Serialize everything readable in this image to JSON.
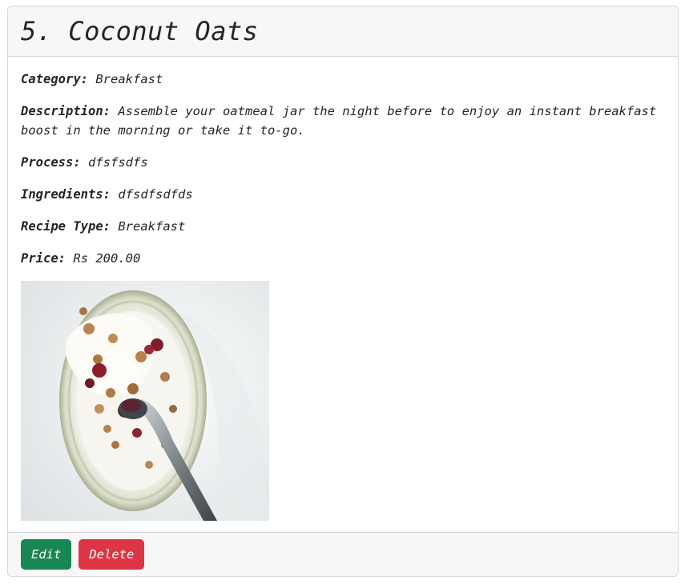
{
  "recipe": {
    "title": "5. Coconut Oats",
    "fields": [
      {
        "label": "Category:",
        "value": "Breakfast"
      },
      {
        "label": "Description:",
        "value": "Assemble your oatmeal jar the night before to enjoy an instant breakfast boost in the morning or take it to-go."
      },
      {
        "label": "Process:",
        "value": "dfsfsdfs"
      },
      {
        "label": "Ingredients:",
        "value": "dfsdfsdfds"
      },
      {
        "label": "Recipe Type:",
        "value": "Breakfast"
      },
      {
        "label": "Price:",
        "value": "Rs 200.00"
      }
    ]
  },
  "actions": {
    "edit_label": "Edit",
    "delete_label": "Delete"
  },
  "colors": {
    "edit": "#198754",
    "delete": "#dc3545"
  }
}
